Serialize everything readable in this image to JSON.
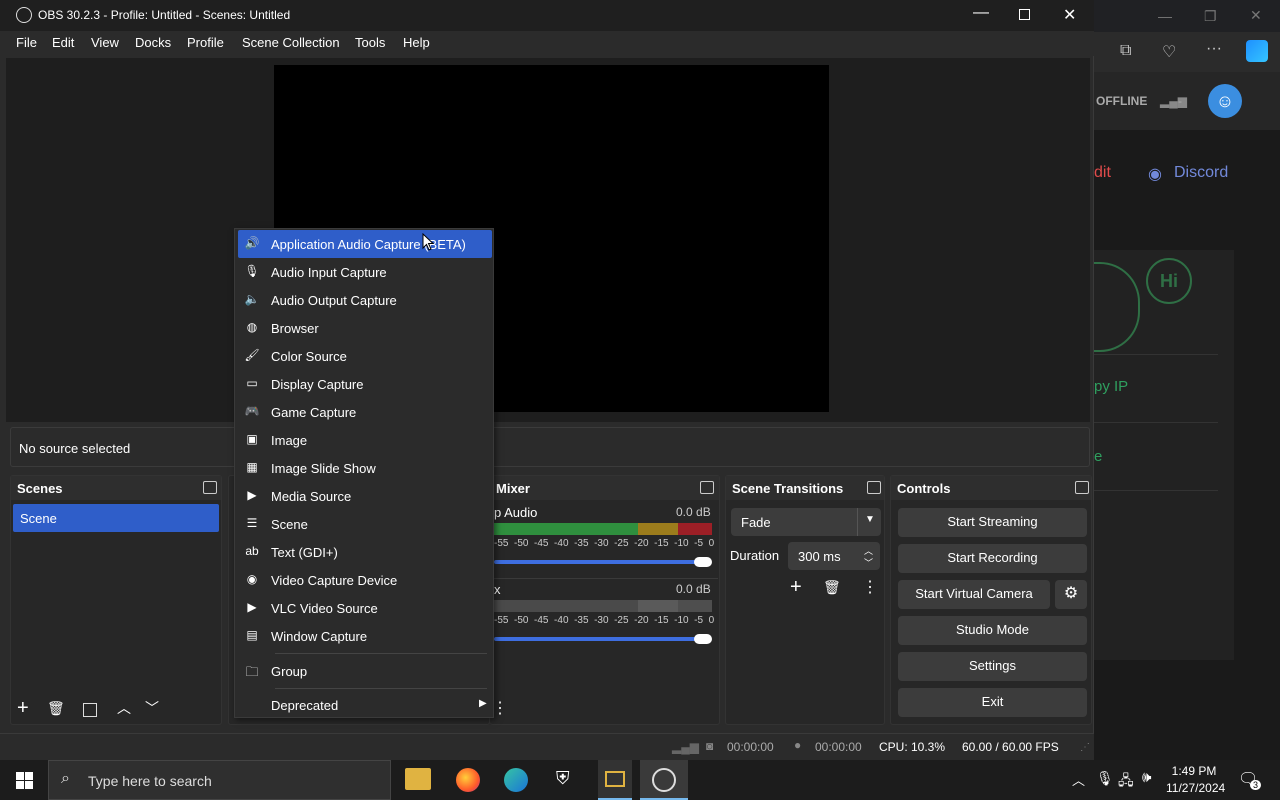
{
  "window": {
    "title": "OBS 30.2.3 - Profile: Untitled - Scenes: Untitled"
  },
  "menu": [
    "File",
    "Edit",
    "View",
    "Docks",
    "Profile",
    "Scene Collection",
    "Tools",
    "Help"
  ],
  "source_bar": {
    "text": "No source selected"
  },
  "context_menu": {
    "items": [
      {
        "label": "Application Audio Capture (BETA)",
        "icon": "app-audio-icon",
        "selected": true
      },
      {
        "label": "Audio Input Capture",
        "icon": "microphone-icon"
      },
      {
        "label": "Audio Output Capture",
        "icon": "speaker-icon"
      },
      {
        "label": "Browser",
        "icon": "globe-icon"
      },
      {
        "label": "Color Source",
        "icon": "brush-icon"
      },
      {
        "label": "Display Capture",
        "icon": "monitor-icon"
      },
      {
        "label": "Game Capture",
        "icon": "gamepad-icon"
      },
      {
        "label": "Image",
        "icon": "image-icon"
      },
      {
        "label": "Image Slide Show",
        "icon": "slideshow-icon"
      },
      {
        "label": "Media Source",
        "icon": "play-icon"
      },
      {
        "label": "Scene",
        "icon": "list-icon"
      },
      {
        "label": "Text (GDI+)",
        "icon": "text-icon"
      },
      {
        "label": "Video Capture Device",
        "icon": "camera-icon"
      },
      {
        "label": "VLC Video Source",
        "icon": "play-icon"
      },
      {
        "label": "Window Capture",
        "icon": "window-icon"
      }
    ],
    "group": {
      "label": "Group",
      "icon": "folder-icon"
    },
    "deprecated": {
      "label": "Deprecated",
      "icon": "submenu-arrow-icon"
    }
  },
  "scenes": {
    "title": "Scenes",
    "items": [
      "Scene"
    ]
  },
  "mixer": {
    "title": "Mixer",
    "channels": [
      {
        "name": "p Audio",
        "db": "0.0 dB",
        "level": 0.0
      },
      {
        "name": "x",
        "db": "0.0 dB",
        "level": 0.0
      }
    ],
    "scale": [
      "-55",
      "-50",
      "-45",
      "-40",
      "-35",
      "-30",
      "-25",
      "-20",
      "-15",
      "-10",
      "-5",
      "0"
    ]
  },
  "transitions": {
    "title": "Scene Transitions",
    "selected": "Fade",
    "duration_label": "Duration",
    "duration_value": "300 ms"
  },
  "controls": {
    "title": "Controls",
    "buttons": [
      "Start Streaming",
      "Start Recording",
      "Start Virtual Camera",
      "Studio Mode",
      "Settings",
      "Exit"
    ]
  },
  "status": {
    "stream_time": "00:00:00",
    "record_time": "00:00:00",
    "cpu": "CPU: 10.3%",
    "fps": "60.00 / 60.00 FPS"
  },
  "background_browser": {
    "offline": "OFFLINE",
    "offline_extra": "-",
    "discord": "Discord",
    "edit_fragment": "dit",
    "ip_fragment": "py IP",
    "e_fragment": "e",
    "hi_text": "Hi"
  },
  "taskbar": {
    "search_placeholder": "Type here to search",
    "time": "1:49 PM",
    "date": "11/27/2024",
    "notif_count": "3"
  },
  "colors": {
    "accent": "#2f5ec9",
    "meter_green": "#2f8f3e",
    "meter_yellow": "#9c7c1c",
    "meter_red": "#9c1f26",
    "discord": "#7289da"
  }
}
